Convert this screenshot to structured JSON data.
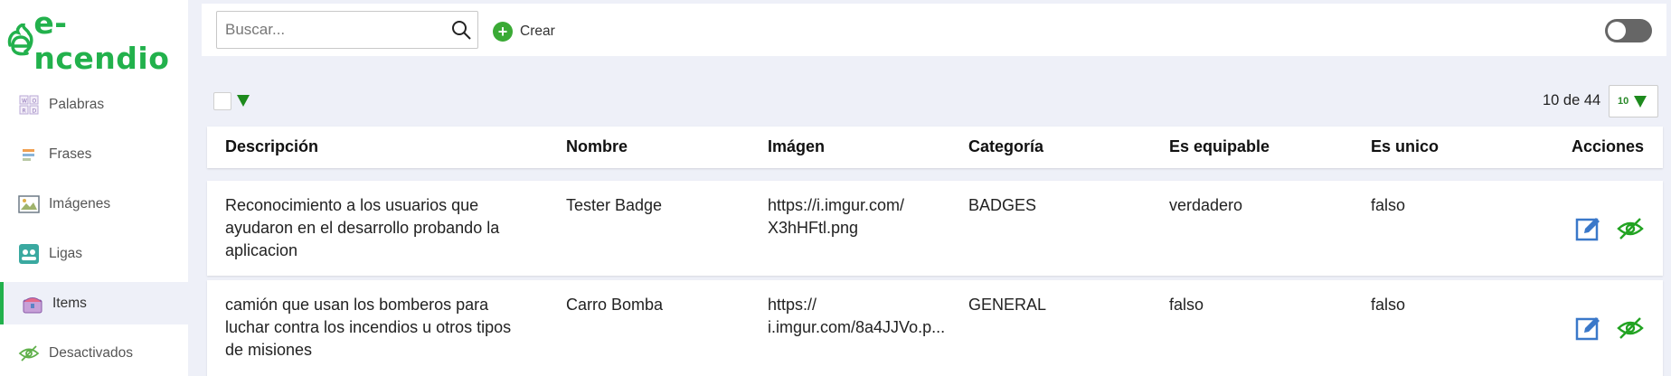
{
  "app": {
    "logo_text": "e-ncendio"
  },
  "sidebar": {
    "items": [
      {
        "label": "Palabras",
        "icon": "words-grid-icon"
      },
      {
        "label": "Frases",
        "icon": "phrases-icon"
      },
      {
        "label": "Imágenes",
        "icon": "image-icon"
      },
      {
        "label": "Ligas",
        "icon": "leagues-icon"
      },
      {
        "label": "Items",
        "icon": "items-chest-icon",
        "active": true
      },
      {
        "label": "Desactivados",
        "icon": "eye-slash-icon"
      }
    ]
  },
  "toolbar": {
    "search_placeholder": "Buscar...",
    "create_label": "Crear",
    "toggle_on": false
  },
  "pagination": {
    "info": "10 de 44",
    "page_size": "10"
  },
  "table": {
    "headers": {
      "descripcion": "Descripción",
      "nombre": "Nombre",
      "imagen": "Imágen",
      "categoria": "Categoría",
      "equipable": "Es equipable",
      "unico": "Es unico",
      "acciones": "Acciones"
    },
    "rows": [
      {
        "descripcion_lines": [
          "Reconocimiento a los usuarios que",
          "ayudaron en el desarrollo probando la",
          "aplicacion"
        ],
        "nombre": "Tester Badge",
        "imagen_lines": [
          "https://i.imgur.com/",
          "X3hHFtl.png"
        ],
        "categoria": "BADGES",
        "equipable": "verdadero",
        "unico": "falso"
      },
      {
        "descripcion_lines": [
          "camión que usan los bomberos para",
          "luchar contra los incendios u otros tipos",
          "de misiones"
        ],
        "nombre": "Carro Bomba",
        "imagen_lines": [
          "https://",
          "i.imgur.com/8a4JJVo.p..."
        ],
        "categoria": "GENERAL",
        "equipable": "falso",
        "unico": "falso"
      }
    ]
  },
  "colors": {
    "brand_green": "#22b14c",
    "edit_blue": "#3a78c9",
    "eye_green": "#22a322",
    "background": "#eef0f8"
  }
}
